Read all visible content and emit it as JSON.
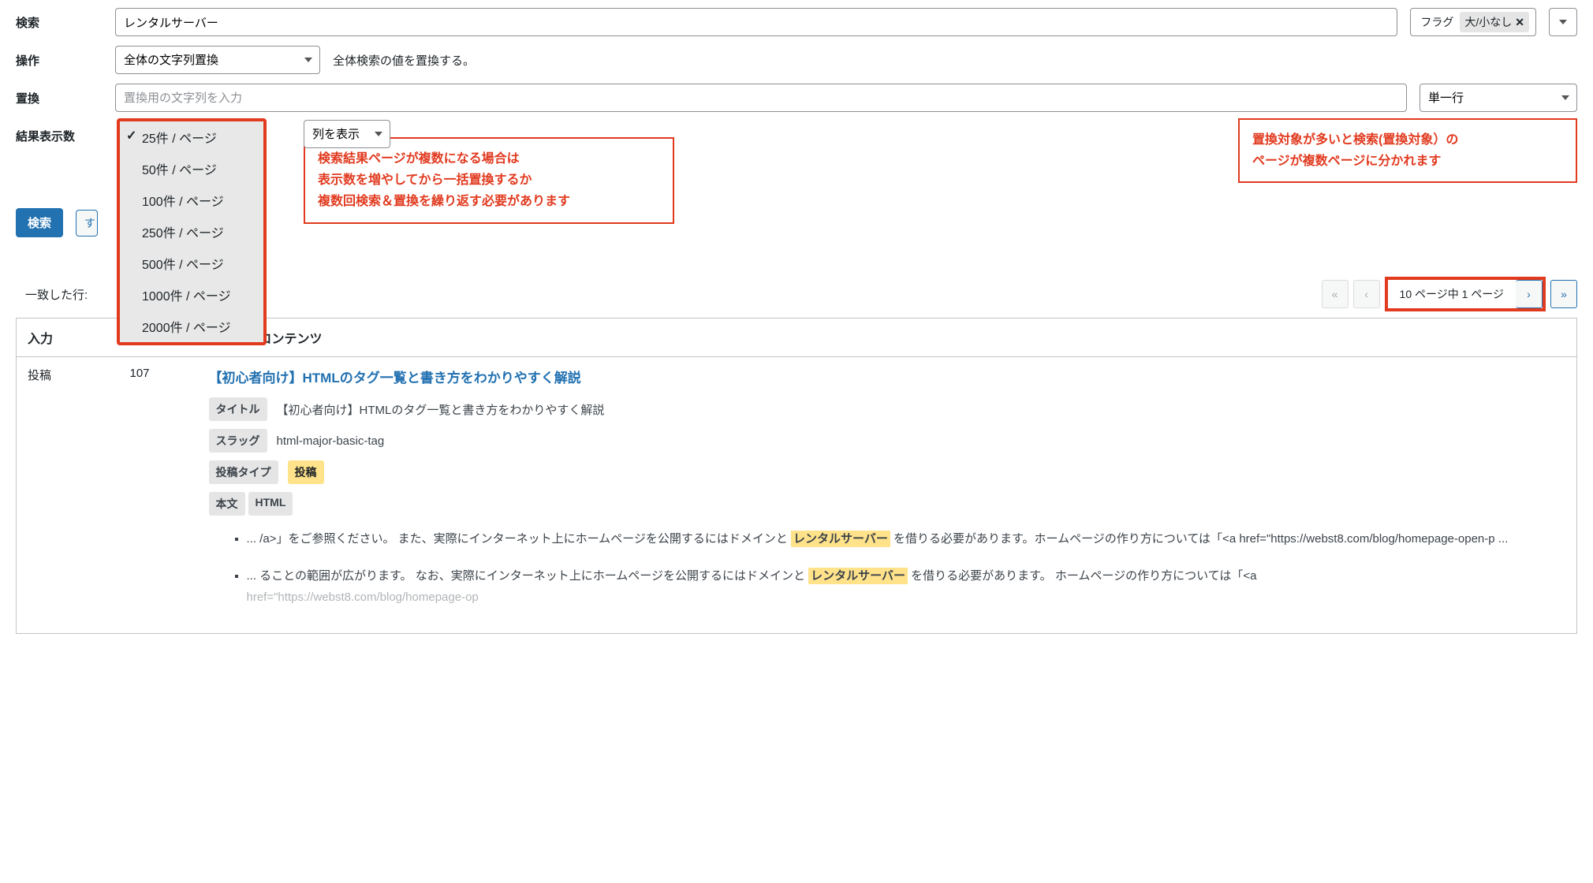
{
  "form": {
    "search_label": "検索",
    "search_value": "レンタルサーバー",
    "flag_label": "フラグ",
    "flag_chip": "大/小なし",
    "operation_label": "操作",
    "operation_value": "全体の文字列置換",
    "operation_hint": "全体検索の値を置換する。",
    "replace_label": "置換",
    "replace_placeholder": "置換用の文字列を入力",
    "replace_mode": "単一行",
    "perpage_label": "結果表示数",
    "columns_btn": "列を表示",
    "search_btn": "検索",
    "secondary_btn_partial": "す"
  },
  "perpage_options": [
    "25件 / ページ",
    "50件 / ページ",
    "100件 / ページ",
    "250件 / ページ",
    "500件 / ページ",
    "1000件 / ページ",
    "2000件 / ページ"
  ],
  "callout_left": {
    "line1": "検索結果ページが複数になる場合は",
    "line2": "表示数を増やしてから一括置換するか",
    "line3": "複数回検索＆置換を繰り返す必要があります"
  },
  "callout_right": {
    "line1": "置換対象が多いと検索(置換対象）の",
    "line2": "ページが複数ページに分かれます"
  },
  "matches_label": "一致した行:",
  "pager": {
    "first": "«",
    "prev": "‹",
    "info": "10 ページ中 1 ページ",
    "next": "›",
    "last": "»"
  },
  "table": {
    "col_input": "入力",
    "col_id": "",
    "col_content": "一致したコンテンツ",
    "row1": {
      "type": "投稿",
      "id": "107",
      "title_link": "【初心者向け】HTMLのタグ一覧と書き方をわかりやすく解説",
      "meta": {
        "title_label": "タイトル",
        "title_val": "【初心者向け】HTMLのタグ一覧と書き方をわかりやすく解説",
        "slug_label": "スラッグ",
        "slug_val": "html-major-basic-tag",
        "posttype_label": "投稿タイプ",
        "posttype_val": "投稿",
        "body_label": "本文",
        "body_mode": "HTML"
      },
      "snippets": [
        {
          "pre": "... /a>」をご参照ください。 また、実際にインターネット上にホームページを公開するにはドメインと ",
          "hl": "レンタルサーバー",
          "post": " を借りる必要があります。ホームページの作り方については「<a href=\"https://webst8.com/blog/homepage-open-p ..."
        },
        {
          "pre": "... ることの範囲が広がります。 なお、実際にインターネット上にホームページを公開するにはドメインと ",
          "hl": "レンタルサーバー",
          "post": " を借りる必要があります。 ホームページの作り方については「<a"
        }
      ],
      "truncated_line": "href=\"https://webst8.com/blog/homepage-op"
    }
  }
}
